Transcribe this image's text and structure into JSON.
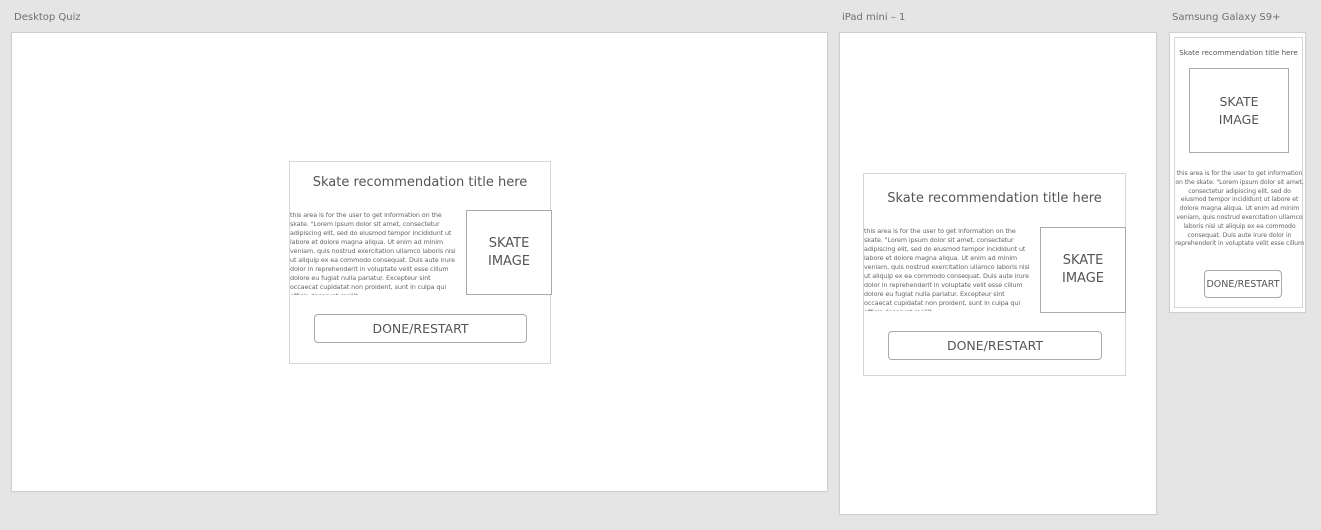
{
  "artboards": {
    "desktop": {
      "label": "Desktop Quiz",
      "card": {
        "title": "Skate recommendation title here",
        "body": "this area is for the user to get information on the skate. \"Lorem ipsum dolor sit amet, consectetur adipiscing elit, sed do eiusmod tempor incididunt ut labore et dolore magna aliqua. Ut enim ad minim veniam, quis nostrud exercitation ullamco laboris nisi ut aliquip ex ea commodo consequat. Duis aute irure dolor in reprehenderit in voluptate velit esse cillum dolore eu fugiat nulla pariatur. Excepteur sint occaecat cupidatat non proident, sunt in culpa qui officia deserunt mollit.",
        "image_label": "SKATE IMAGE",
        "button_label": "DONE/RESTART"
      }
    },
    "ipad": {
      "label": "iPad mini – 1",
      "card": {
        "title": "Skate recommendation title here",
        "body": "this area is for the user to get information on the skate. \"Lorem ipsum dolor sit amet, consectetur adipiscing elit, sed do eiusmod tempor incididunt ut labore et dolore magna aliqua. Ut enim ad minim veniam, quis nostrud exercitation ullamco laboris nisi ut aliquip ex ea commodo consequat. Duis aute irure dolor in reprehenderit in voluptate velit esse cillum dolore eu fugiat nulla pariatur. Excepteur sint occaecat cupidatat non proident, sunt in culpa qui officia deserunt mollit.",
        "image_label": "SKATE IMAGE",
        "button_label": "DONE/RESTART"
      }
    },
    "samsung": {
      "label": "Samsung Galaxy S9+",
      "card": {
        "title": "Skate recommendation title here",
        "body": "this area is for the user to get information on the skate. \"Lorem ipsum dolor sit amet, consectetur adipiscing elit, sed do eiusmod tempor incididunt ut labore et dolore magna aliqua. Ut enim ad minim veniam, quis nostrud exercitation ullamco laboris nisi ut aliquip ex ea commodo consequat. Duis aute irure dolor in reprehenderit in voluptate velit esse cillum",
        "image_label": "SKATE IMAGE",
        "button_label": "DONE/RESTART"
      }
    }
  },
  "colors": {
    "canvas": "#e5e5e5",
    "artboard": "#ffffff",
    "border": "#a9a9a9",
    "text": "#555555"
  }
}
